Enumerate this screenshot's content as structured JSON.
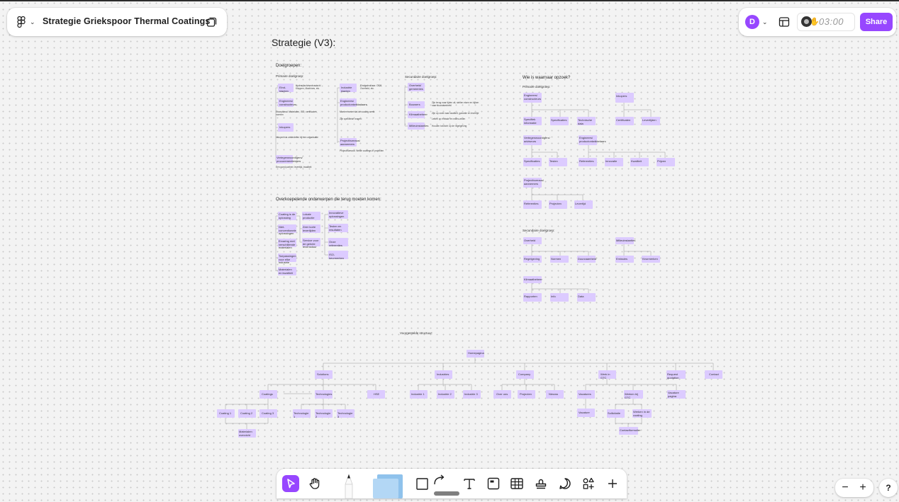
{
  "app": {
    "file_title": "Strategie Griekspoor Thermal Coatings",
    "avatar_initial": "D",
    "timer": "03:00",
    "share_label": "Share",
    "accent_color": "#9747ff",
    "sticky_color": "#dccbff"
  },
  "toolbar": {
    "tools": [
      "move-tool",
      "hand-tool",
      "pencil-tool",
      "sticky-note-tool",
      "shape-tool",
      "connector-tool",
      "text-tool",
      "section-tool",
      "table-tool",
      "stamp-tool",
      "comment-tool",
      "widgets-tool",
      "more-tool"
    ]
  },
  "zoom": {
    "minus": "−",
    "plus": "+",
    "help": "?"
  },
  "board": {
    "title": "Strategie (V3):",
    "doelgroepen": {
      "heading": "Doelgroepen:",
      "primair_label": "Primaire doelgroep:",
      "secundair_label": "Secundaire doelgroep:",
      "primary_stickies": [
        "Eind-klanten",
        "Engineers/ constructeurs",
        "Inkopers",
        "Vertegenwoordigers/ procurementleiders"
      ],
      "primary_notes": [
        "Hydraulisch/mechanisch/ Kleppen, Machines, etc.",
        "Exceptional: Materialen, ISO, certificaten, normen",
        "Inkopen via onderdelen bij een organisatie",
        "Een goed partner, levertijd, kwaliteit"
      ],
      "middle_stickies": [
        "Industrie klanten",
        "Engineers/ productontwikkelaars",
        "Projectbureaus/ aannemers"
      ],
      "middle_notes": [
        "Eindgebruikers: OEM, Overheid, etc.",
        "Moeten weten dat de coating werkt",
        "Zijn specifieke vragen:",
        "Projectbureaus: Welke coatings in projecten"
      ],
      "secondary_stickies": [
        "Overheid/ gemeentes",
        "Bouwers",
        "Klimaatbeheer",
        "Milieuinstanties"
      ],
      "secondary_notes": [
        "Zijn terug naar tijden uit, stellen eisen en kijken naar duurzaamheid",
        "Zijn op zoek naar kwaliteit, garantie en levertijd",
        "Letten op emissie en milieu-eisen",
        "Houden toezicht op de regelgeving"
      ]
    },
    "overkoepelend": {
      "heading": "Overkoepelende onderwerpen die terug moeten komen:",
      "col1": [
        "Coating is de oplossing",
        "Niet-conventionele oplossingen",
        "Ervaring met verschillende materialen",
        "Toepassingen voor elke industrie",
        "Materialen en kwaliteit"
      ],
      "col2": [
        "Lokale productie",
        "Zeer korte levertijden",
        "Service voor de gehele levensduur"
      ],
      "col3": [
        "Innovatieve oplossingen",
        "Testen en resultaten",
        "Onze referenties",
        "ISO-keurmerken"
      ]
    },
    "wie": {
      "heading": "Wie is waarnaar opzoek?",
      "primair_label": "Primaire doelgroep:",
      "secundair_label": "Secundaire doelgroep:",
      "row1_parents": [
        "Engineers/ constructeurs",
        "Inkopers"
      ],
      "row1_children": [
        "Specifiek informatie",
        "Specificaties",
        "Technische data",
        "Certificaten",
        "Levertijden"
      ],
      "row2_parents": [
        "Vertegenwoordigers/ adviseurs",
        "Engineers/ productontwikkelaars"
      ],
      "row2_children": [
        "Specificaties",
        "Testen",
        "Referenties",
        "Innovatie",
        "Kwaliteit",
        "Prijzen",
        "Service"
      ],
      "row3_parent": "Projectbureaus/ aannemers",
      "row3_children": [
        "Referenties",
        "Projecten",
        "Levertijd"
      ],
      "sec_parents": [
        "Overheid",
        "Milieuinstanties",
        "Klimaatbeheer"
      ],
      "sec_children": [
        "Regelgeving",
        "Normen",
        "Duurzaamheid",
        "Emissies",
        "Keurmerken",
        "Rapporten",
        "Info",
        "Data"
      ]
    },
    "structuur": {
      "heading": "Voorgestelde structuur:",
      "root": "Homepagina",
      "level1": [
        "Solutions",
        "Industries",
        "Company",
        "Werk in GTC",
        "Request quotation",
        "Contact"
      ],
      "solutions_children": [
        "Coatings",
        "Technologies",
        "HSE"
      ],
      "coatings_children": [
        "Coating 1",
        "Coating 2",
        "Coating 3"
      ],
      "technologies_children": [
        "Technologie 1",
        "Technologie 2",
        "Technologie 3"
      ],
      "coatings_bottom": "Materialen overzicht",
      "industries_children": [
        "Industrie 1",
        "Industrie 2",
        "Industrie 3"
      ],
      "company_children": [
        "Over ons",
        "Projecten",
        "Nieuws"
      ],
      "werk_children": [
        "Vacatures",
        "Werken bij GTC",
        "Vacature pagina"
      ],
      "vacatures_children": [
        "Vacature"
      ],
      "werken_children": [
        "Sollicitatie",
        "Werken in de coating"
      ],
      "werken_bottom": "Contactformulier"
    }
  }
}
